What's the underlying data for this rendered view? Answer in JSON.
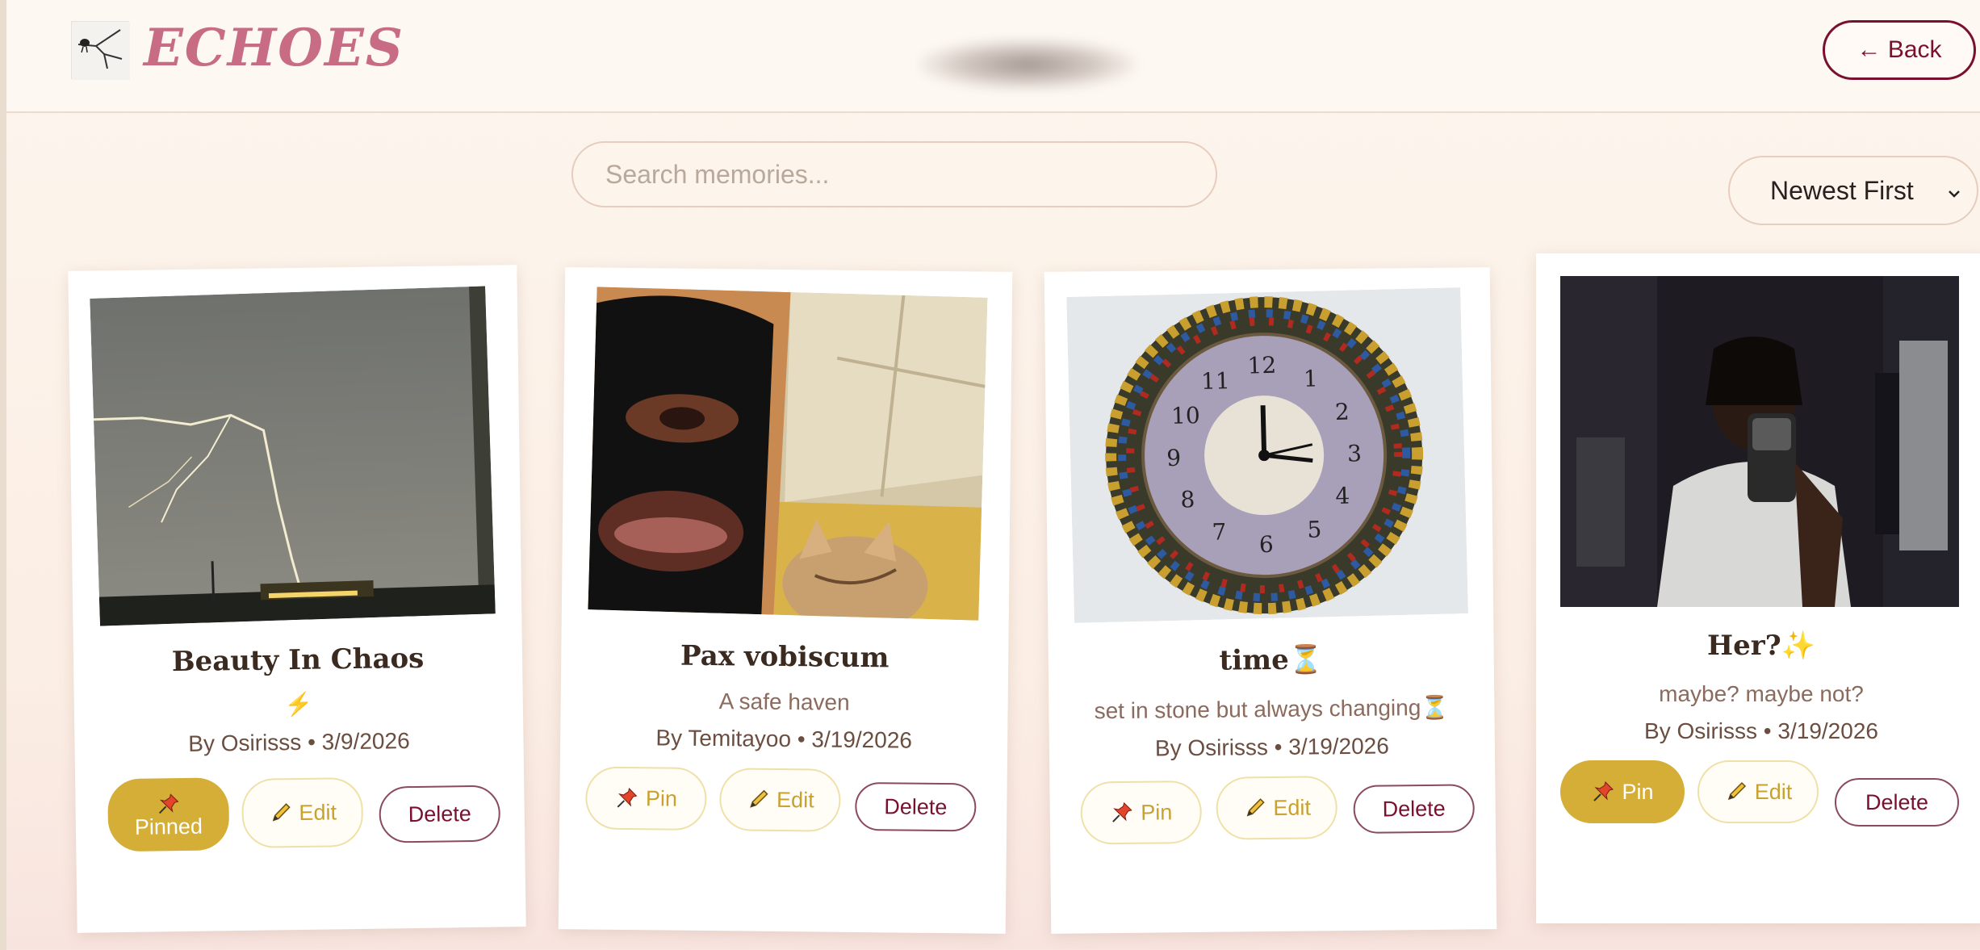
{
  "header": {
    "brand": "ECHOES",
    "back_label": "← Back"
  },
  "search": {
    "placeholder": "Search memories..."
  },
  "sort": {
    "selected": "Newest First"
  },
  "cards": [
    {
      "title": "Beauty In Chaos",
      "caption": "⚡",
      "author_line": "By Osirisss • 3/9/2026",
      "pin_label": "Pinned",
      "edit_label": "Edit",
      "delete_label": "Delete",
      "photo": "lightning-storm-photo"
    },
    {
      "title": "Pax vobiscum",
      "caption": "A safe haven",
      "author_line": "By Temitayoo • 3/19/2026",
      "pin_label": "Pin",
      "edit_label": "Edit",
      "delete_label": "Delete",
      "photo": "balaclava-kitten-photo"
    },
    {
      "title": "time⏳",
      "caption": "set in stone but always changing⏳",
      "author_line": "By Osirisss • 3/19/2026",
      "pin_label": "Pin",
      "edit_label": "Edit",
      "delete_label": "Delete",
      "photo": "wall-clock-photo"
    },
    {
      "title": "Her?✨",
      "caption": "maybe? maybe not?",
      "author_line": "By Osirisss • 3/19/2026",
      "pin_label": "Pin",
      "edit_label": "Edit",
      "delete_label": "Delete",
      "photo": "mirror-selfie-photo"
    }
  ],
  "colors": {
    "brand": "#c86b85",
    "accent": "#7a1030",
    "pin_gold": "#d4ae36",
    "background": "#fdf6ee"
  },
  "icons": [
    "pushpin-icon",
    "pencil-icon",
    "chevron-down-icon"
  ]
}
